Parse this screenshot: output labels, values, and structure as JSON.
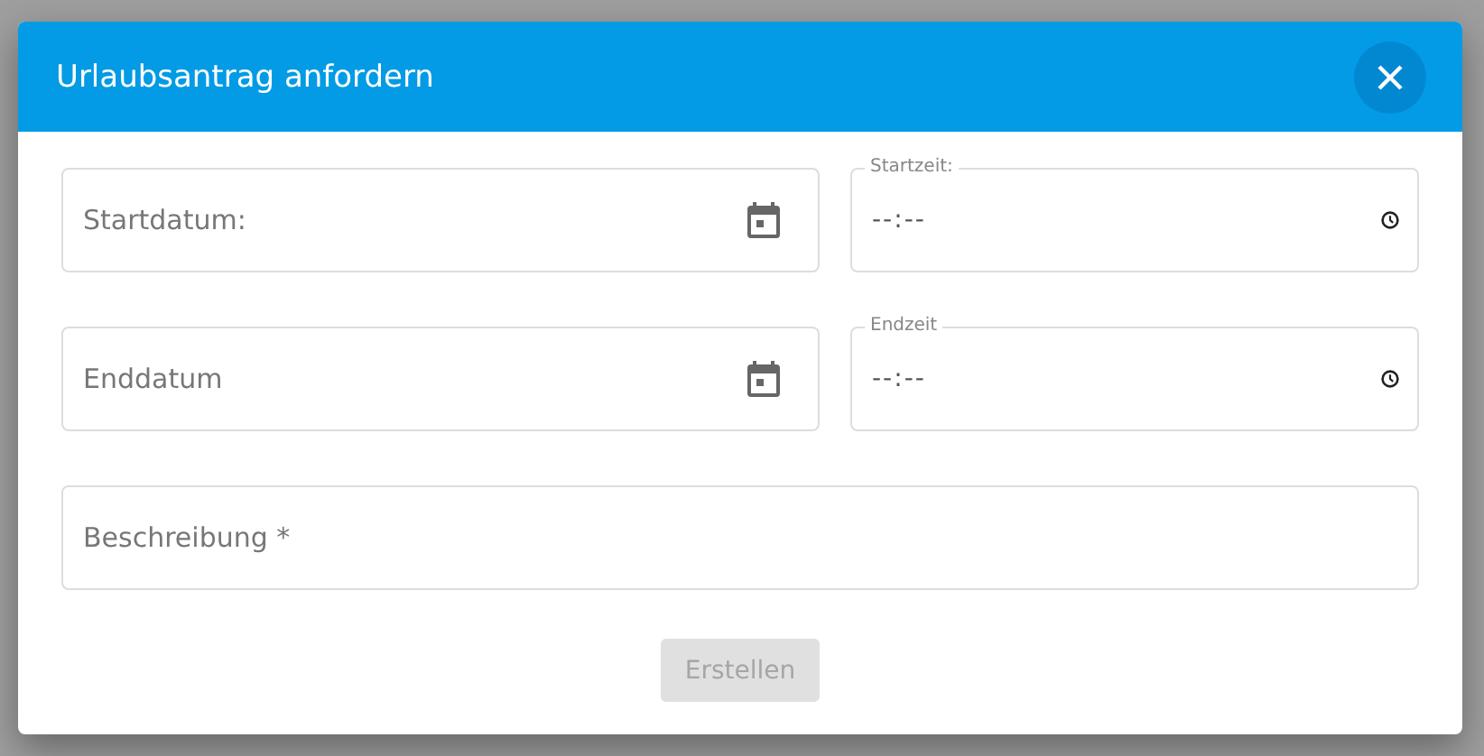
{
  "dialog": {
    "title": "Urlaubsantrag anfordern"
  },
  "rows": [
    [
      {
        "kind": "date",
        "placeholder": "Startdatum:"
      },
      {
        "kind": "time",
        "label": "Startzeit:",
        "value": "--:--"
      }
    ],
    [
      {
        "kind": "date",
        "placeholder": "Enddatum"
      },
      {
        "kind": "time",
        "label": "Endzeit",
        "value": "--:--"
      }
    ],
    [
      {
        "kind": "text",
        "placeholder": "Beschreibung *"
      }
    ]
  ],
  "submit": {
    "label": "Erstellen",
    "disabled": true
  }
}
